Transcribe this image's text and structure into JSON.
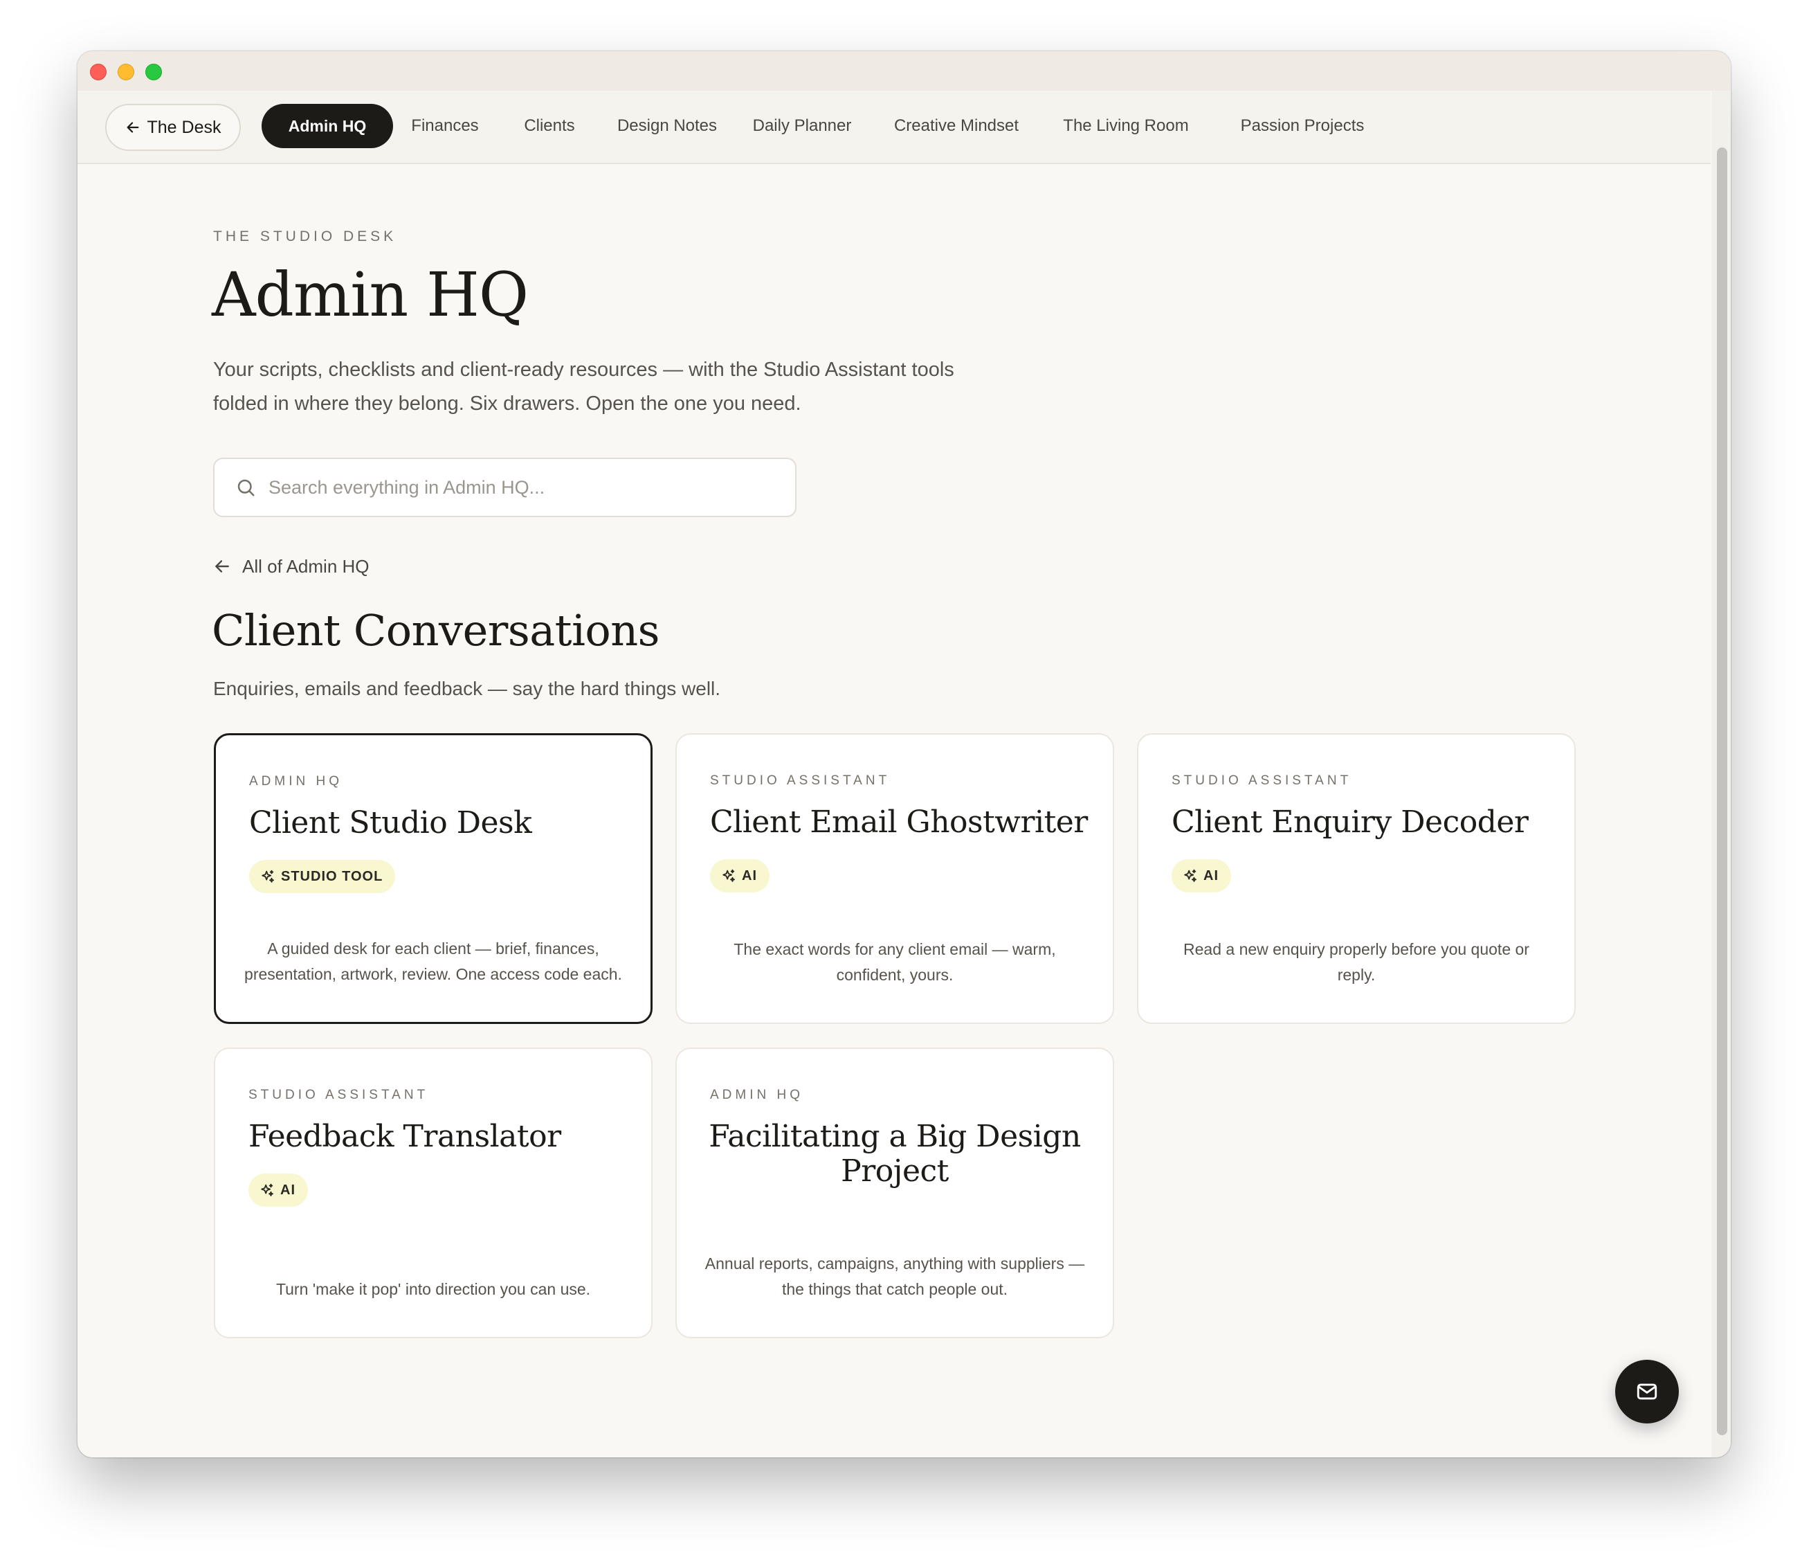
{
  "nav": {
    "back_label": "The Desk",
    "tabs": [
      {
        "label": "Admin HQ",
        "active": true
      },
      {
        "label": "Finances",
        "active": false
      },
      {
        "label": "Clients",
        "active": false
      },
      {
        "label": "Design Notes",
        "active": false
      },
      {
        "label": "Daily Planner",
        "active": false
      },
      {
        "label": "Creative Mindset",
        "active": false
      },
      {
        "label": "The Living Room",
        "active": false
      },
      {
        "label": "Passion Projects",
        "active": false
      }
    ]
  },
  "header": {
    "eyebrow": "THE STUDIO DESK",
    "title": "Admin HQ",
    "lede": "Your scripts, checklists and client-ready resources — with the Studio Assistant tools folded in where they belong. Six drawers. Open the one you need."
  },
  "search": {
    "placeholder": "Search everything in Admin HQ...",
    "value": ""
  },
  "back_link": "All of Admin HQ",
  "section": {
    "title": "Client Conversations",
    "subtitle": "Enquiries, emails and feedback — say the hard things well."
  },
  "cards": [
    {
      "kicker": "ADMIN HQ",
      "title": "Client Studio Desk",
      "badge": "STUDIO TOOL",
      "description": "A guided desk for each client — brief, finances, presentation, artwork, review. One access code each.",
      "selected": true
    },
    {
      "kicker": "STUDIO ASSISTANT",
      "title": "Client Email Ghostwriter",
      "badge": "AI",
      "description": "The exact words for any client email — warm, confident, yours.",
      "selected": false
    },
    {
      "kicker": "STUDIO ASSISTANT",
      "title": "Client Enquiry Decoder",
      "badge": "AI",
      "description": "Read a new enquiry properly before you quote or reply.",
      "selected": false
    },
    {
      "kicker": "STUDIO ASSISTANT",
      "title": "Feedback Translator",
      "badge": "AI",
      "description": "Turn 'make it pop' into direction you can use.",
      "selected": false
    },
    {
      "kicker": "ADMIN HQ",
      "title": "Facilitating a Big Design Project",
      "badge": "",
      "description": "Annual reports, campaigns, anything with suppliers — the things that catch people out.",
      "selected": false
    }
  ],
  "icons": {
    "back": "arrow-left-icon",
    "search": "search-icon",
    "badge": "sparkles-icon",
    "fab": "mail-icon"
  },
  "colors": {
    "ink": "#1d1b17",
    "page_bg": "#f9f8f5",
    "badge_bg": "#f8f7cf",
    "muted_text": "#57534c"
  }
}
